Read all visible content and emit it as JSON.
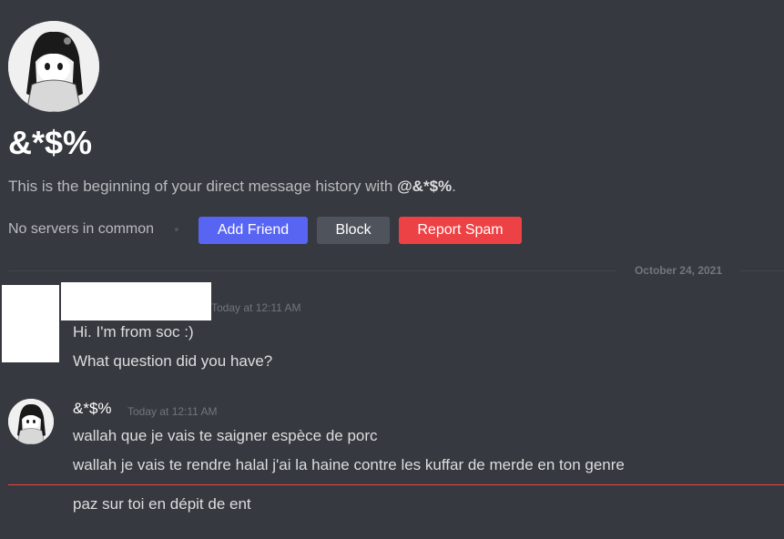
{
  "dm": {
    "username": "&*$%",
    "intro_prefix": "This is the beginning of your direct message history with ",
    "intro_mention": "@&*$%",
    "intro_suffix": ".",
    "mutual": "No servers in common",
    "buttons": {
      "add_friend": "Add Friend",
      "block": "Block",
      "report_spam": "Report Spam"
    }
  },
  "divider": {
    "date": "October 24, 2021"
  },
  "messages": [
    {
      "author": "",
      "timestamp": "Today at 12:11 AM",
      "lines": [
        "Hi. I'm from soc :)",
        "What question did you have?"
      ]
    },
    {
      "author": "&*$%",
      "timestamp": "Today at 12:11 AM",
      "lines": [
        "wallah que je vais te saigner espèce de porc",
        "wallah je vais te rendre halal j'ai la haine contre les kuffar de merde en ton genre",
        "paz sur toi en dépit de ent"
      ]
    }
  ],
  "colors": {
    "background": "#36393f",
    "blurple": "#5865f2",
    "grey_button": "#4f545c",
    "red": "#ed4245"
  }
}
